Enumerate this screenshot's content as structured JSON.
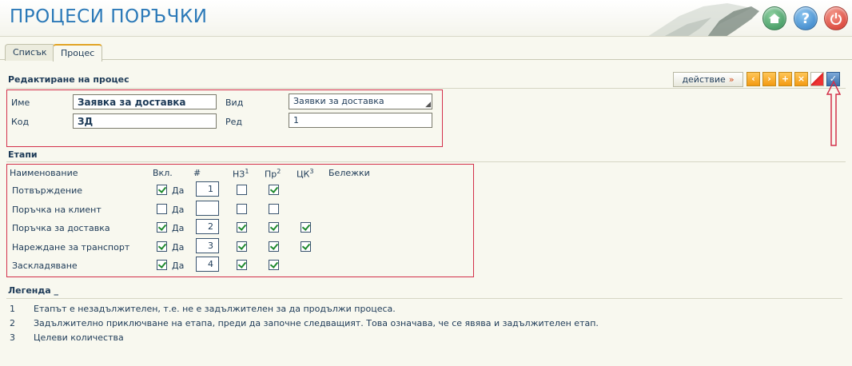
{
  "header": {
    "title": "ПРОЦЕСИ ПОРЪЧКИ",
    "buttons": [
      {
        "name": "home-icon"
      },
      {
        "name": "help-icon",
        "glyph": "?"
      },
      {
        "name": "power-icon"
      }
    ]
  },
  "tabs": [
    {
      "label": "Списък",
      "active": false
    },
    {
      "label": "Процес",
      "active": true
    }
  ],
  "edit": {
    "title": "Редактиране на процес",
    "action_label": "действие",
    "action_glyph": "»",
    "toolbar": [
      "chevron-left-icon",
      "chevron-right-icon",
      "plus-icon",
      "close-icon",
      "clear-icon",
      "check-icon"
    ],
    "fields": {
      "name_label": "Име",
      "name_value": "Заявка за доставка",
      "code_label": "Код",
      "code_value": "ЗД",
      "type_label": "Вид",
      "type_value": "Заявки за доставка",
      "order_label": "Ред",
      "order_value": "1"
    }
  },
  "stages": {
    "title": "Етапи",
    "columns": {
      "name": "Наименование",
      "included": "Вкл.",
      "number": "#",
      "nz": "НЗ",
      "nz_sup": "1",
      "pr": "Пр",
      "pr_sup": "2",
      "ck": "ЦК",
      "ck_sup": "3",
      "notes": "Бележки"
    },
    "yes_label": "Да",
    "rows": [
      {
        "name": "Потвърждение",
        "included": true,
        "number": "1",
        "nz": false,
        "pr": true,
        "ck": null
      },
      {
        "name": "Поръчка на клиент",
        "included": false,
        "number": "",
        "nz": false,
        "pr": false,
        "ck": null
      },
      {
        "name": "Поръчка за доставка",
        "included": true,
        "number": "2",
        "nz": true,
        "pr": true,
        "ck": true
      },
      {
        "name": "Нареждане за транспорт",
        "included": true,
        "number": "3",
        "nz": true,
        "pr": true,
        "ck": true
      },
      {
        "name": "Заскладяване",
        "included": true,
        "number": "4",
        "nz": true,
        "pr": true,
        "ck": null
      }
    ]
  },
  "legend": {
    "title": "Легенда _",
    "items": [
      {
        "num": "1",
        "text": "Етапът е незадължителен, т.е. не е задължителен за да продължи процеса."
      },
      {
        "num": "2",
        "text": "Задължително приключване на етапа, преди да започне следващият. Това означава, че се явява и задължителен етап."
      },
      {
        "num": "3",
        "text": "Целеви количества"
      }
    ]
  },
  "colors": {
    "title": "#2b79b8",
    "annotation": "#d3304a",
    "toolbar_orange": "#f39a12",
    "toolbar_blue": "#3a6fa8"
  }
}
